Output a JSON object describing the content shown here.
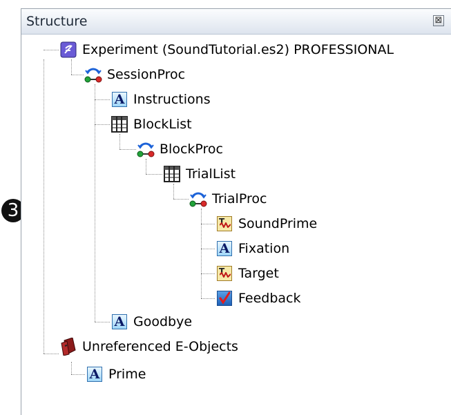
{
  "panel": {
    "title": "Structure",
    "close_glyph": "⊠"
  },
  "callout": {
    "number": "3"
  },
  "tree": [
    {
      "id": "experiment",
      "label": "Experiment (SoundTutorial.es2) PROFESSIONAL",
      "icon": "experiment-icon"
    },
    {
      "id": "sessionproc",
      "label": "SessionProc",
      "icon": "procedure-icon"
    },
    {
      "id": "instructions",
      "label": "Instructions",
      "icon": "text-display-icon"
    },
    {
      "id": "blocklist",
      "label": "BlockList",
      "icon": "list-icon"
    },
    {
      "id": "blockproc",
      "label": "BlockProc",
      "icon": "procedure-icon"
    },
    {
      "id": "triallist",
      "label": "TrialList",
      "icon": "list-icon"
    },
    {
      "id": "trialproc",
      "label": "TrialProc",
      "icon": "procedure-icon"
    },
    {
      "id": "soundprime",
      "label": "SoundPrime",
      "icon": "sound-out-icon"
    },
    {
      "id": "fixation",
      "label": "Fixation",
      "icon": "text-display-icon"
    },
    {
      "id": "target",
      "label": "Target",
      "icon": "sound-out-icon"
    },
    {
      "id": "feedback",
      "label": "Feedback",
      "icon": "feedback-icon"
    },
    {
      "id": "goodbye",
      "label": "Goodbye",
      "icon": "text-display-icon"
    },
    {
      "id": "unreferenced",
      "label": "Unreferenced E-Objects",
      "icon": "briefcase-icon"
    },
    {
      "id": "prime",
      "label": "Prime",
      "icon": "text-display-icon"
    }
  ]
}
